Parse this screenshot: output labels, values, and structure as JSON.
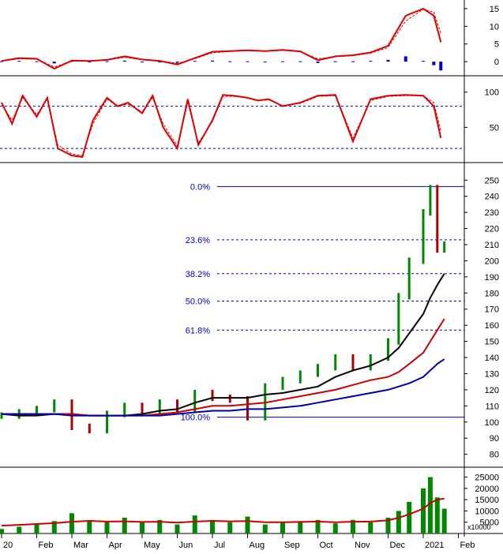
{
  "chart_data": [
    {
      "type": "line",
      "panel": "macd",
      "ylim": [
        -4,
        17
      ],
      "yticks": [
        "15",
        "10",
        "5",
        "0"
      ],
      "ytick_values": [
        15,
        10,
        5,
        0
      ],
      "x_month_index": [
        0,
        0.5,
        1,
        1.5,
        2,
        2.5,
        3,
        3.5,
        4,
        4.5,
        5,
        5.5,
        6,
        6.5,
        7,
        7.5,
        8,
        8.5,
        9,
        9.5,
        10,
        10.5,
        11,
        11.5,
        12,
        12.3,
        12.5
      ],
      "series": [
        {
          "role": "macd",
          "color": "#dd0000",
          "values": [
            0.2,
            1.0,
            0.8,
            -2.0,
            0.3,
            0.2,
            0.5,
            1.5,
            0.6,
            0.2,
            -0.8,
            1.0,
            2.8,
            3.0,
            3.2,
            3.0,
            3.3,
            2.9,
            0.4,
            1.5,
            1.8,
            2.6,
            4.5,
            13.0,
            15.0,
            13.0,
            5.5
          ]
        },
        {
          "role": "signal",
          "color": "#dd0000",
          "dashed": true,
          "values": [
            0.1,
            0.8,
            0.7,
            -1.5,
            0.1,
            0.2,
            0.4,
            1.2,
            0.6,
            0.3,
            -0.5,
            0.8,
            2.5,
            2.9,
            3.1,
            3.0,
            3.2,
            2.8,
            0.8,
            1.4,
            1.7,
            2.4,
            4.0,
            11.5,
            14.8,
            14.0,
            8.0
          ]
        },
        {
          "role": "histogram",
          "color": "#0000cc",
          "values": [
            0.1,
            0.2,
            0.1,
            -0.5,
            0.2,
            0.0,
            0.1,
            0.3,
            0.0,
            -0.1,
            -0.3,
            0.2,
            0.3,
            0.1,
            0.1,
            0.0,
            0.1,
            0.1,
            -0.4,
            0.1,
            0.1,
            0.2,
            0.5,
            1.5,
            0.2,
            -1.0,
            -2.5
          ]
        }
      ]
    },
    {
      "type": "line",
      "panel": "stochastic",
      "ylim": [
        0,
        112
      ],
      "yticks": [
        "100",
        "50"
      ],
      "ytick_values": [
        100,
        50
      ],
      "reference_lines": [
        80,
        20
      ],
      "x_month_index": [
        0,
        0.3,
        0.6,
        1,
        1.3,
        1.6,
        2,
        2.3,
        2.6,
        3,
        3.3,
        3.6,
        4,
        4.3,
        4.6,
        5,
        5.3,
        5.6,
        6,
        6.3,
        6.6,
        7,
        7.3,
        7.6,
        8,
        8.5,
        9,
        9.5,
        10,
        10.5,
        11,
        11.5,
        12,
        12.3,
        12.5
      ],
      "series": [
        {
          "role": "k",
          "color": "#dd0000",
          "values": [
            85,
            55,
            95,
            65,
            92,
            20,
            10,
            8,
            60,
            92,
            80,
            85,
            70,
            95,
            50,
            20,
            90,
            25,
            60,
            96,
            95,
            92,
            88,
            90,
            80,
            85,
            95,
            96,
            30,
            90,
            95,
            96,
            95,
            80,
            35
          ]
        },
        {
          "role": "d",
          "color": "#dd0000",
          "dashed": true,
          "values": [
            83,
            60,
            92,
            68,
            90,
            25,
            12,
            10,
            55,
            90,
            80,
            83,
            72,
            92,
            55,
            24,
            85,
            28,
            58,
            94,
            94,
            92,
            88,
            89,
            81,
            84,
            94,
            95,
            35,
            88,
            94,
            95,
            95,
            85,
            45
          ]
        }
      ]
    },
    {
      "type": "line",
      "panel": "price",
      "ylim": [
        72,
        256
      ],
      "yticks": [
        "250",
        "240",
        "230",
        "220",
        "210",
        "200",
        "190",
        "180",
        "170",
        "160",
        "150",
        "140",
        "130",
        "120",
        "110",
        "100",
        "90",
        "80"
      ],
      "ytick_values": [
        250,
        240,
        230,
        220,
        210,
        200,
        190,
        180,
        170,
        160,
        150,
        140,
        130,
        120,
        110,
        100,
        90,
        80
      ],
      "x_month_index": [
        0,
        0.5,
        1,
        1.5,
        2,
        2.5,
        3,
        3.5,
        4,
        4.5,
        5,
        5.5,
        6,
        6.5,
        7,
        7.5,
        8,
        8.5,
        9,
        9.5,
        10,
        10.5,
        11,
        11.3,
        11.6,
        12,
        12.2,
        12.4,
        12.6
      ],
      "series": [
        {
          "role": "close",
          "color": "#008800",
          "values": [
            104,
            106,
            108,
            112,
            97,
            95,
            105,
            110,
            107,
            112,
            108,
            118,
            115,
            114,
            103,
            122,
            126,
            130,
            134,
            140,
            134,
            140,
            150,
            178,
            200,
            230,
            245,
            207,
            210
          ]
        },
        {
          "role": "ma-short",
          "color": "#000000",
          "values": [
            105,
            104,
            104,
            105,
            105,
            104,
            104,
            104,
            105,
            107,
            108,
            112,
            115,
            115,
            115,
            117,
            118,
            120,
            122,
            128,
            132,
            135,
            140,
            146,
            155,
            167,
            177,
            185,
            192
          ]
        },
        {
          "role": "ma-mid",
          "color": "#cc0000",
          "values": [
            105,
            105,
            105,
            105,
            105,
            104,
            104,
            104,
            104,
            105,
            106,
            108,
            110,
            110,
            111,
            112,
            114,
            116,
            118,
            120,
            123,
            126,
            128,
            131,
            136,
            143,
            150,
            157,
            164
          ]
        },
        {
          "role": "ma-long",
          "color": "#0000aa",
          "values": [
            105,
            105,
            105,
            105,
            104,
            104,
            104,
            104,
            104,
            104,
            105,
            106,
            107,
            107,
            108,
            108,
            109,
            110,
            112,
            114,
            116,
            118,
            120,
            122,
            124,
            128,
            132,
            136,
            139
          ]
        }
      ],
      "fibonacci": [
        {
          "label": "0.0%",
          "value": 246,
          "dashed": false
        },
        {
          "label": "23.6%",
          "value": 213,
          "dashed": true
        },
        {
          "label": "38.2%",
          "value": 192,
          "dashed": true
        },
        {
          "label": "50.0%",
          "value": 175,
          "dashed": true
        },
        {
          "label": "61.8%",
          "value": 157,
          "dashed": true
        },
        {
          "label": "100.0%",
          "value": 103,
          "dashed": false
        }
      ]
    },
    {
      "type": "bar",
      "panel": "volume",
      "ylim": [
        0,
        28000
      ],
      "yticks": [
        "25000",
        "20000",
        "15000",
        "10000",
        "5000"
      ],
      "ytick_values": [
        25000,
        20000,
        15000,
        10000,
        5000
      ],
      "unit": "x10000",
      "x_month_index": [
        0,
        0.5,
        1,
        1.5,
        2,
        2.5,
        3,
        3.5,
        4,
        4.5,
        5,
        5.5,
        6,
        6.5,
        7,
        7.5,
        8,
        8.5,
        9,
        9.5,
        10,
        10.5,
        11,
        11.3,
        11.6,
        12,
        12.2,
        12.4,
        12.6
      ],
      "series": [
        {
          "role": "volume",
          "color": "#008800",
          "values": [
            2000,
            3000,
            4500,
            5500,
            9000,
            6000,
            5000,
            7000,
            5000,
            6000,
            4000,
            8000,
            6000,
            5000,
            7500,
            4000,
            5000,
            5500,
            6000,
            4500,
            6000,
            5000,
            7000,
            10000,
            14000,
            20000,
            25000,
            16000,
            11000
          ]
        },
        {
          "role": "volume-ma",
          "color": "#cc0000",
          "values": [
            3500,
            3800,
            4200,
            4600,
            5200,
            5600,
            5300,
            5400,
            5100,
            5200,
            4800,
            5300,
            5600,
            5400,
            5500,
            5000,
            5000,
            5100,
            5300,
            5000,
            5200,
            5300,
            5800,
            7000,
            8500,
            11000,
            13500,
            15000,
            15500
          ]
        }
      ]
    }
  ],
  "x_axis": {
    "labels": [
      "20",
      "Feb",
      "Mar",
      "Apr",
      "May",
      "Jun",
      "Jul",
      "Aug",
      "Sep",
      "Oct",
      "Nov",
      "Dec",
      "2021",
      "Feb"
    ],
    "month_index": [
      0,
      1,
      2,
      3,
      4,
      5,
      6,
      7,
      8,
      9,
      10,
      11,
      12,
      13
    ]
  }
}
